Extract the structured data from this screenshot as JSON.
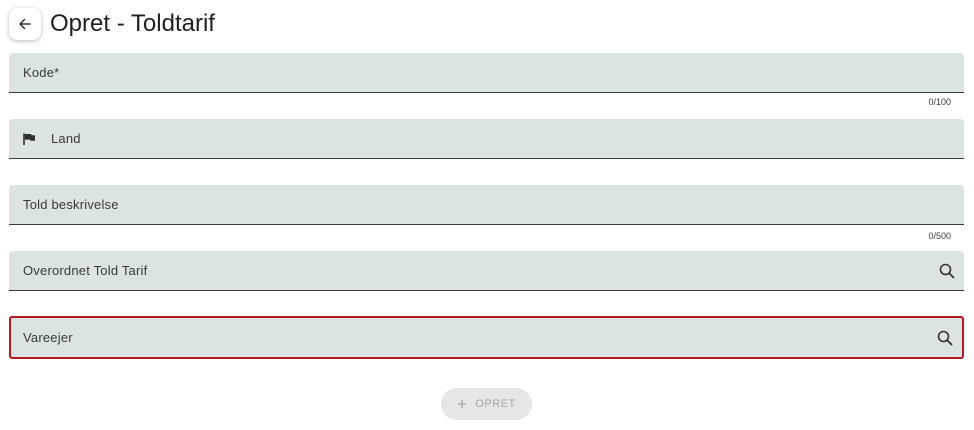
{
  "header": {
    "title": "Opret - Toldtarif",
    "back_icon": "arrow-left-icon"
  },
  "form": {
    "kode": {
      "label": "Kode*",
      "value": "",
      "counter": "0/100"
    },
    "land": {
      "label": "Land",
      "value": "",
      "icon": "flag-icon"
    },
    "beskrivelse": {
      "label": "Told beskrivelse",
      "value": "",
      "counter": "0/500"
    },
    "overordnet": {
      "label": "Overordnet Told Tarif",
      "value": "",
      "icon": "search-icon"
    },
    "vareejer": {
      "label": "Vareejer",
      "value": "",
      "icon": "search-icon",
      "state": "error"
    }
  },
  "actions": {
    "create_label": "OPRET",
    "create_icon": "plus-icon",
    "create_enabled": false
  },
  "colors": {
    "field_bg": "#dbe3e3",
    "error": "#b3181f",
    "disabled_bg": "#e6e6e6",
    "disabled_text": "#a6a6a6"
  }
}
